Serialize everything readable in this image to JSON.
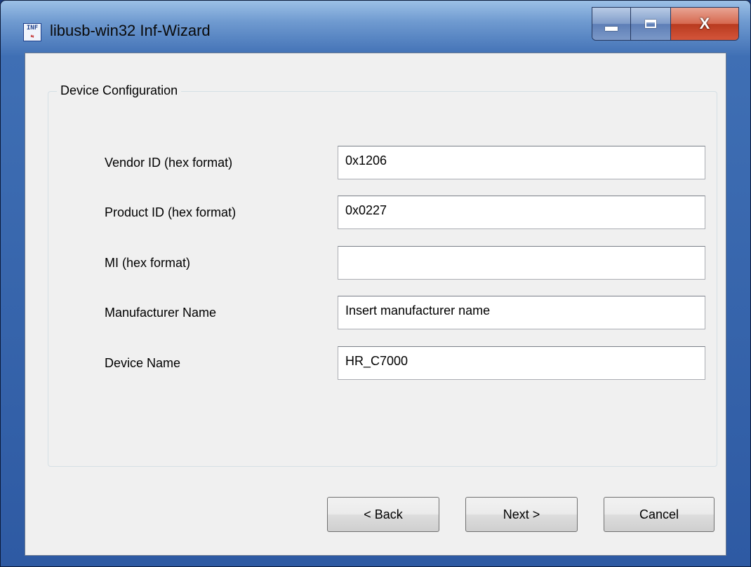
{
  "window": {
    "title": "libusb-win32 Inf-Wizard",
    "icon": "inf-usb-icon",
    "icon_text": "INF",
    "controls": {
      "minimize": "minimize-icon",
      "maximize": "maximize-icon",
      "close_label": "X"
    }
  },
  "group": {
    "title": "Device Configuration",
    "fields": [
      {
        "label": "Vendor ID (hex format)",
        "value": "0x1206"
      },
      {
        "label": "Product ID (hex format)",
        "value": "0x0227"
      },
      {
        "label": "MI (hex format)",
        "value": ""
      },
      {
        "label": "Manufacturer Name",
        "value": "Insert manufacturer name"
      },
      {
        "label": "Device Name",
        "value": "HR_C7000"
      }
    ]
  },
  "buttons": {
    "back": "< Back",
    "next": "Next >",
    "cancel": "Cancel"
  }
}
